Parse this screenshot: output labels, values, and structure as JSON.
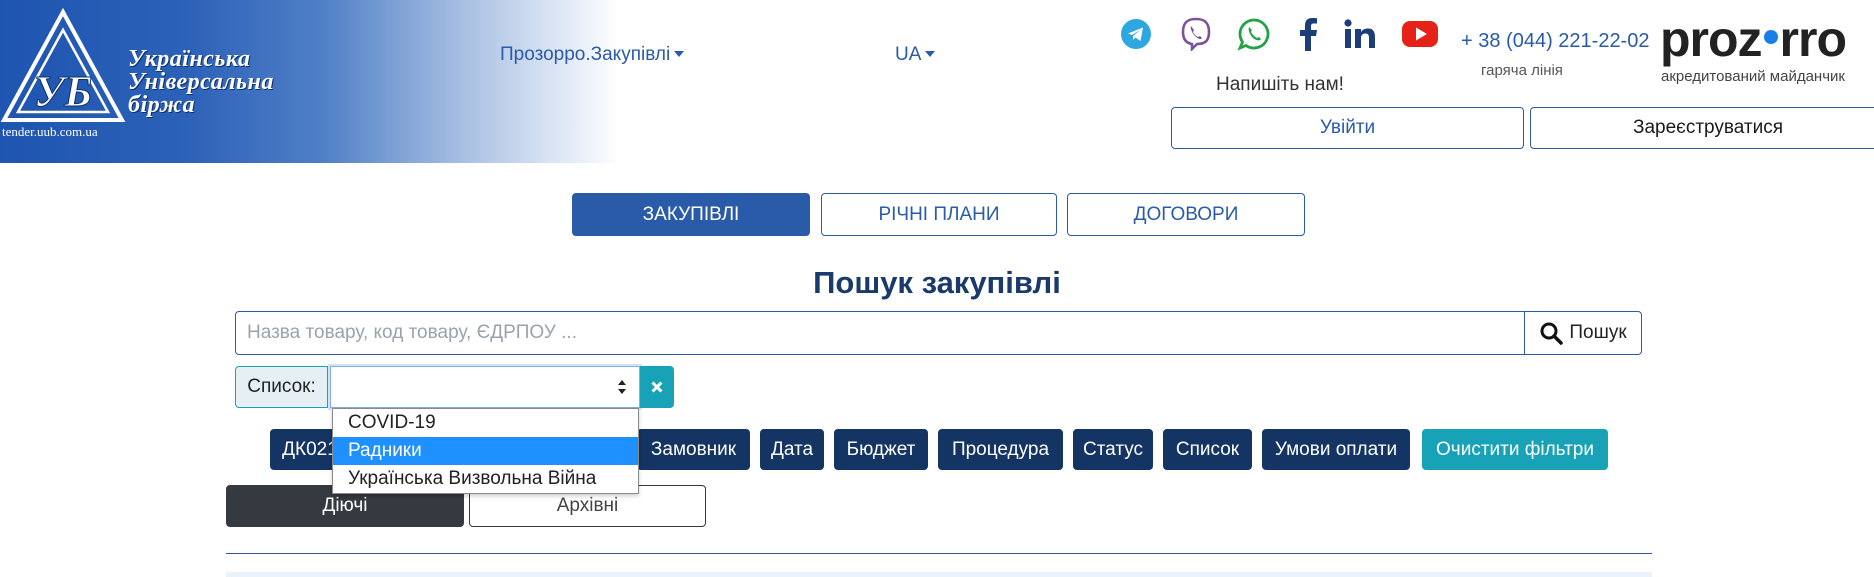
{
  "brand": {
    "logo_lines": [
      "Українська",
      "Універсальна",
      "біржа"
    ],
    "logo_url": "tender.uub.com.ua"
  },
  "nav": {
    "prozorro_menu": "Прозорро.Закупівлі",
    "language": "UA"
  },
  "contact": {
    "socials": [
      "telegram-icon",
      "viber-icon",
      "whatsapp-icon",
      "facebook-icon",
      "linkedin-icon",
      "youtube-icon"
    ],
    "write_us": "Напишіть нам!",
    "phone": "+ 38 (044) 221-22-02",
    "hotline": "гаряча лінія",
    "prozorro_logo": "proz",
    "prozorro_logo_tail": "rro",
    "accredited": "акредитований майданчик"
  },
  "auth": {
    "login": "Увійти",
    "register": "Зареєструватися"
  },
  "tabs": [
    {
      "label": "Закупівлі",
      "active": true
    },
    {
      "label": "Річні плани",
      "active": false
    },
    {
      "label": "Договори",
      "active": false
    }
  ],
  "page_title": "Пошук закупівлі",
  "search": {
    "placeholder": "Назва товару, код товару, ЄДРПОУ ...",
    "value": "",
    "button": "Пошук"
  },
  "list_filter": {
    "label": "Список:",
    "selected": "",
    "options": [
      "COVID-19",
      "Радники",
      "Українська Визвольна Війна"
    ],
    "highlighted_option": "Радники"
  },
  "filters": [
    "ДК021",
    "Замовник",
    "Дата",
    "Бюджет",
    "Процедура",
    "Статус",
    "Список",
    "Умови оплати"
  ],
  "clear_filters": "Очистити фільтри",
  "state": {
    "active": "Діючі",
    "archive": "Архівні"
  },
  "colors": {
    "primary": "#2a5ba8",
    "dark_filter": "#143463",
    "teal": "#17a2b8",
    "dropdown_highlight": "#1e90ff"
  }
}
